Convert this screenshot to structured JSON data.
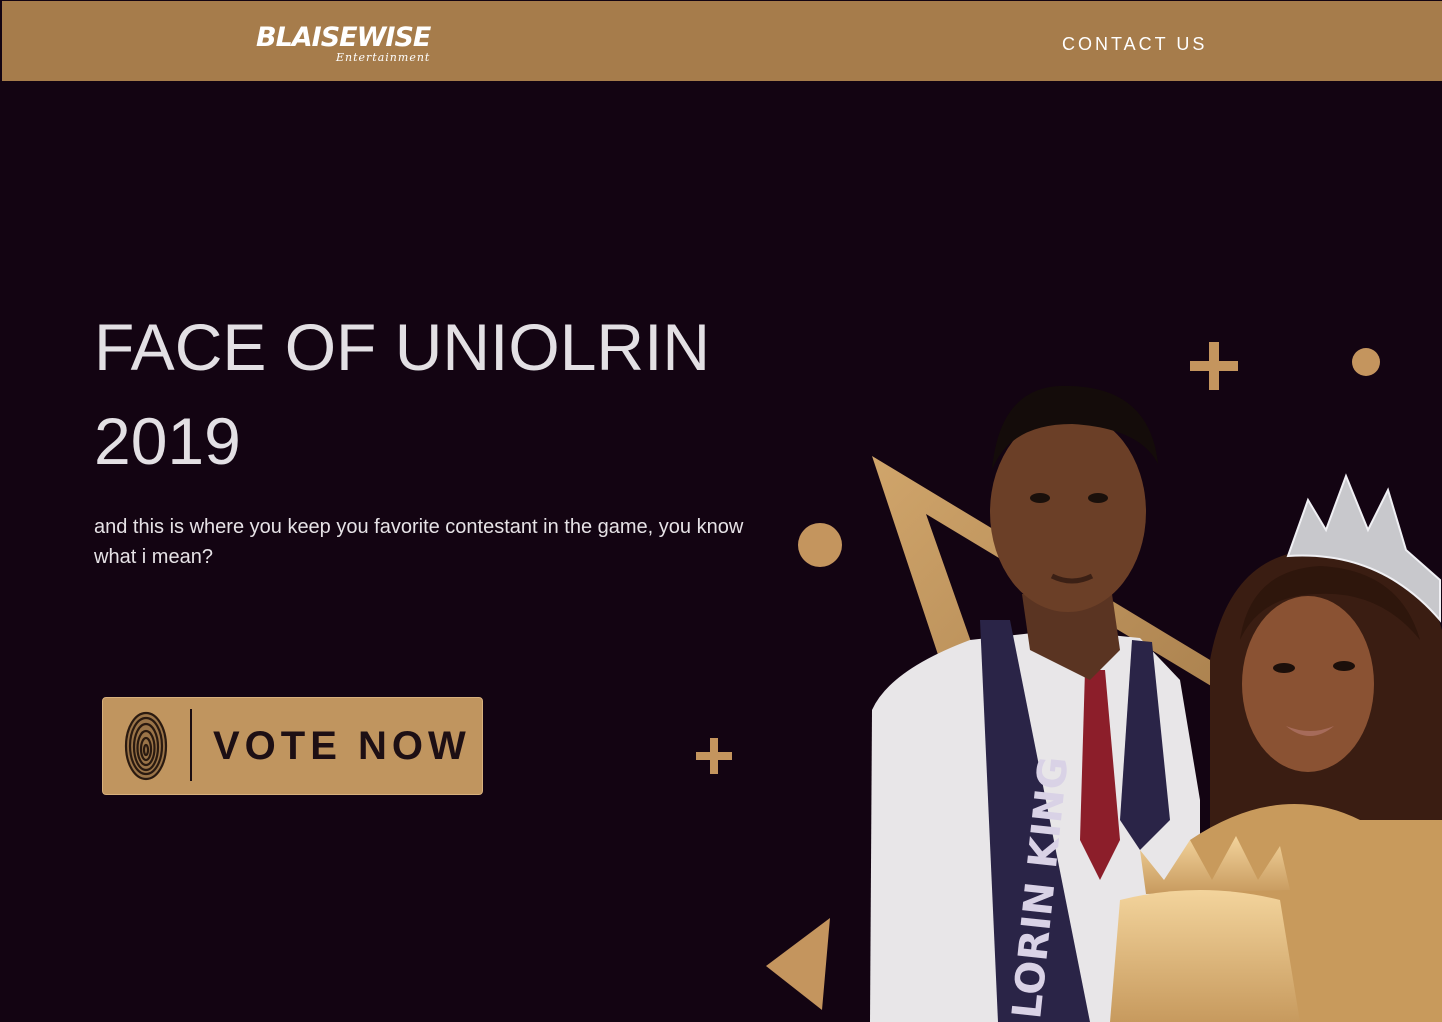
{
  "header": {
    "logo_text": "BLAISEWISE",
    "logo_sub": "Entertainment",
    "contact_label": "CONTACT US"
  },
  "hero": {
    "title_line1": "FACE OF UNIOLRIN",
    "title_line2": "2019",
    "description": "and this is where you keep you favorite contestant in the game, you know what i mean?",
    "vote_label": "VOTE NOW",
    "sash_text": "LORIN KING"
  },
  "colors": {
    "background": "#130412",
    "nav": "#a67c4b",
    "gold": "#c4955e",
    "text": "#e3e0e4"
  },
  "icons": [
    "lion-icon",
    "fingerprint-icon",
    "plus-icon",
    "circle-icon",
    "triangle-icon",
    "crown-icon"
  ]
}
